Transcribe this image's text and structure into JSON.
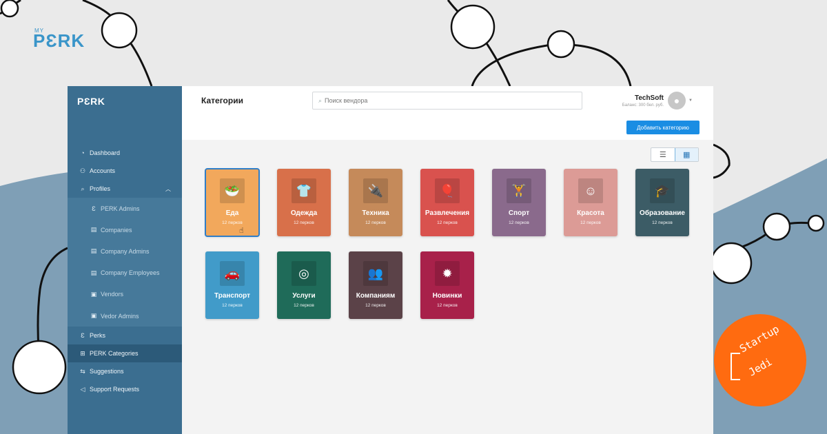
{
  "brand": {
    "prefix": "MY",
    "name": "PƐRK"
  },
  "badge": {
    "line1": "Startup",
    "line2": "Jedi"
  },
  "sidebar": {
    "logo": "PƐRK",
    "items": [
      {
        "label": "Dashboard",
        "icon": "pie-chart-icon"
      },
      {
        "label": "Accounts",
        "icon": "users-icon"
      },
      {
        "label": "Profiles",
        "icon": "search-icon"
      },
      {
        "label": "Perks",
        "icon": "perk-icon"
      },
      {
        "label": "PERK Categories",
        "icon": "grid-icon"
      },
      {
        "label": "Suggestions",
        "icon": "swap-icon"
      },
      {
        "label": "Support Requests",
        "icon": "megaphone-icon"
      }
    ],
    "sub_items": [
      {
        "label": "PERK Admins"
      },
      {
        "label": "Companies"
      },
      {
        "label": "Company Admins"
      },
      {
        "label": "Company Employees"
      },
      {
        "label": "Vendors"
      },
      {
        "label": "Vedor Admins"
      }
    ]
  },
  "header": {
    "title": "Категории",
    "search_placeholder": "Поиск вендора",
    "user_name": "TechSoft",
    "user_balance": "Баланс: 300 бел. руб.",
    "add_button": "Добавить категорию"
  },
  "categories": [
    {
      "name": "Еда",
      "count": "12 перков",
      "color": "#f2a85c",
      "icon": "food-icon"
    },
    {
      "name": "Одежда",
      "count": "12 перков",
      "color": "#d8704a",
      "icon": "clothes-icon"
    },
    {
      "name": "Техника",
      "count": "12 перков",
      "color": "#c58a5a",
      "icon": "tech-icon"
    },
    {
      "name": "Развлечения",
      "count": "12 перков",
      "color": "#d9524e",
      "icon": "balloons-icon"
    },
    {
      "name": "Спорт",
      "count": "12 перков",
      "color": "#8a6a8c",
      "icon": "dumbbell-icon"
    },
    {
      "name": "Красота",
      "count": "12 перков",
      "color": "#dc9b96",
      "icon": "face-icon"
    },
    {
      "name": "Образование",
      "count": "12 перков",
      "color": "#3c5c66",
      "icon": "graduation-cap-icon"
    },
    {
      "name": "Транспорт",
      "count": "12 перков",
      "color": "#419bc9",
      "icon": "car-icon"
    },
    {
      "name": "Услуги",
      "count": "12 перков",
      "color": "#1f6b59",
      "icon": "lifebuoy-icon"
    },
    {
      "name": "Компаниям",
      "count": "12 перков",
      "color": "#5b4248",
      "icon": "team-icon"
    },
    {
      "name": "Новинки",
      "count": "12 перков",
      "color": "#a8214a",
      "icon": "new-badge-icon"
    }
  ],
  "colors": {
    "sidebar": "#3b6e90",
    "accent": "#1a8de3",
    "badge": "#ff6b10",
    "brand": "#3a95c9"
  }
}
